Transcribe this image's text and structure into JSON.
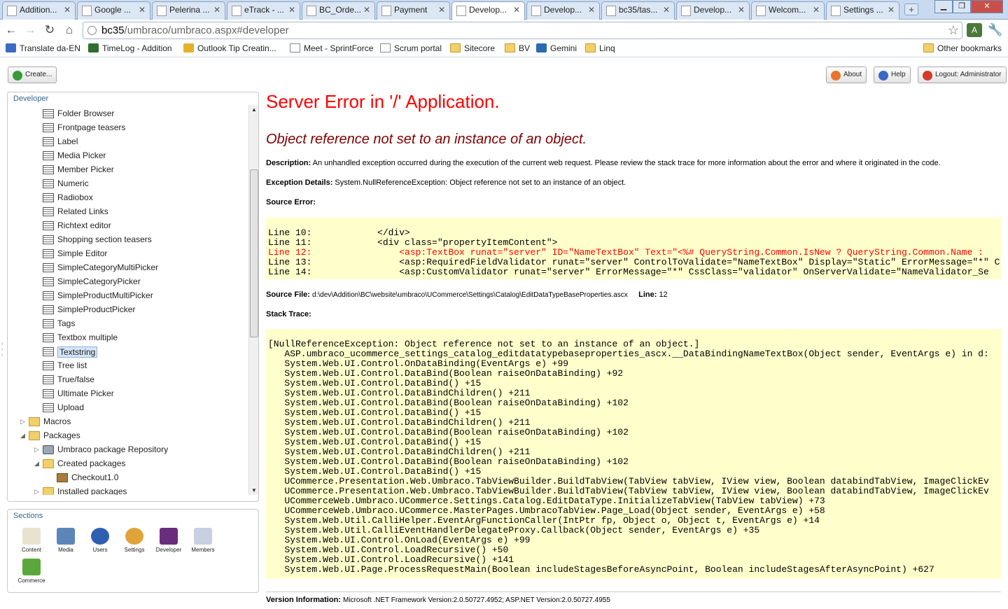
{
  "browser": {
    "tabs": [
      {
        "label": "Addition...",
        "active": false
      },
      {
        "label": "Google ...",
        "active": false
      },
      {
        "label": "Pelerina ...",
        "active": false
      },
      {
        "label": "eTrack - ...",
        "active": false
      },
      {
        "label": "BC_Orde...",
        "active": false
      },
      {
        "label": "Payment",
        "active": false
      },
      {
        "label": "Develop...",
        "active": true
      },
      {
        "label": "Develop...",
        "active": false
      },
      {
        "label": "bc35/tas...",
        "active": false
      },
      {
        "label": "Develop...",
        "active": false
      },
      {
        "label": "Welcom...",
        "active": false
      },
      {
        "label": "Settings ...",
        "active": false
      }
    ],
    "url_host": "bc35",
    "url_path": "/umbraco/umbraco.aspx#developer",
    "bookmarks": [
      {
        "label": "Translate da-EN",
        "icon": "translate-icon"
      },
      {
        "label": "TimeLog - Addition",
        "icon": "star-icon"
      },
      {
        "label": "Outlook Tip Creatin...",
        "icon": "outlook-icon"
      },
      {
        "label": "Meet - SprintForce",
        "icon": "page-icon"
      },
      {
        "label": "Scrum portal",
        "icon": "page-icon"
      },
      {
        "label": "Sitecore",
        "icon": "folder-icon"
      },
      {
        "label": "BV",
        "icon": "folder-icon"
      },
      {
        "label": "Gemini",
        "icon": "gemini-icon"
      },
      {
        "label": "Linq",
        "icon": "folder-icon"
      }
    ],
    "other_bookmarks": "Other bookmarks"
  },
  "umbraco": {
    "create_label": "Create...",
    "about_label": "About",
    "help_label": "Help",
    "logout_label": "Logout: Administrator",
    "tree_title": "Developer",
    "tree_items": [
      {
        "label": "Folder Browser",
        "icon": "datatype-icon"
      },
      {
        "label": "Frontpage teasers",
        "icon": "datatype-icon"
      },
      {
        "label": "Label",
        "icon": "datatype-icon"
      },
      {
        "label": "Media Picker",
        "icon": "datatype-icon"
      },
      {
        "label": "Member Picker",
        "icon": "datatype-icon"
      },
      {
        "label": "Numeric",
        "icon": "datatype-icon"
      },
      {
        "label": "Radiobox",
        "icon": "datatype-icon"
      },
      {
        "label": "Related Links",
        "icon": "datatype-icon"
      },
      {
        "label": "Richtext editor",
        "icon": "datatype-icon"
      },
      {
        "label": "Shopping section teasers",
        "icon": "datatype-icon"
      },
      {
        "label": "Simple Editor",
        "icon": "datatype-icon"
      },
      {
        "label": "SimpleCategoryMultiPicker",
        "icon": "datatype-icon"
      },
      {
        "label": "SimpleCategoryPicker",
        "icon": "datatype-icon"
      },
      {
        "label": "SimpleProductMultiPicker",
        "icon": "datatype-icon"
      },
      {
        "label": "SimpleProductPicker",
        "icon": "datatype-icon"
      },
      {
        "label": "Tags",
        "icon": "datatype-icon"
      },
      {
        "label": "Textbox multiple",
        "icon": "datatype-icon"
      },
      {
        "label": "Textstring",
        "icon": "datatype-icon",
        "selected": true
      },
      {
        "label": "Tree list",
        "icon": "datatype-icon"
      },
      {
        "label": "True/false",
        "icon": "datatype-icon"
      },
      {
        "label": "Ultimate Picker",
        "icon": "datatype-icon"
      },
      {
        "label": "Upload",
        "icon": "datatype-icon"
      },
      {
        "label": "Macros",
        "icon": "folder-icon"
      },
      {
        "label": "Packages",
        "icon": "folder-icon"
      },
      {
        "label": "Umbraco package Repository",
        "icon": "repository-icon"
      },
      {
        "label": "Created packages",
        "icon": "folder-icon"
      },
      {
        "label": "Checkout1.0",
        "icon": "package-icon"
      },
      {
        "label": "Installed packages",
        "icon": "folder-icon"
      }
    ],
    "sections_title": "Sections",
    "sections": [
      {
        "label": "Content",
        "icon": "content-icon"
      },
      {
        "label": "Media",
        "icon": "media-icon"
      },
      {
        "label": "Users",
        "icon": "users-icon"
      },
      {
        "label": "Settings",
        "icon": "settings-icon"
      },
      {
        "label": "Developer",
        "icon": "developer-icon"
      },
      {
        "label": "Members",
        "icon": "members-icon"
      },
      {
        "label": "Commerce",
        "icon": "commerce-icon"
      }
    ]
  },
  "error": {
    "title": "Server Error in '/' Application.",
    "message": "Object reference not set to an instance of an object.",
    "description_label": "Description:",
    "description": "An unhandled exception occurred during the execution of the current web request. Please review the stack trace for more information about the error and where it originated in the code.",
    "exception_label": "Exception Details:",
    "exception": "System.NullReferenceException: Object reference not set to an instance of an object.",
    "source_error_label": "Source Error:",
    "source_lines": [
      {
        "text": "Line 10:            </div>",
        "highlight": false
      },
      {
        "text": "Line 11:            <div class=\"propertyItemContent\">",
        "highlight": false
      },
      {
        "text": "Line 12:                <asp:TextBox runat=\"server\" ID=\"NameTextBox\" Text=\"<%# QueryString.Common.IsNew ? QueryString.Common.Name :",
        "highlight": true
      },
      {
        "text": "Line 13:                <asp:RequiredFieldValidator runat=\"server\" ControlToValidate=\"NameTextBox\" Display=\"Static\" ErrorMessage=\"*\" C",
        "highlight": false
      },
      {
        "text": "Line 14:                <asp:CustomValidator runat=\"server\" ErrorMessage=\"*\" CssClass=\"validator\" OnServerValidate=\"NameValidator_Se",
        "highlight": false
      }
    ],
    "source_file_label": "Source File:",
    "source_file": "d:\\dev\\Addition\\BC\\website\\umbraco\\UCommerce\\Settings\\Catalog\\EditDataTypeBaseProperties.ascx",
    "line_label": "Line:",
    "line": "12",
    "stack_label": "Stack Trace:",
    "stack_lines": [
      "[NullReferenceException: Object reference not set to an instance of an object.]",
      "   ASP.umbraco_ucommerce_settings_catalog_editdatatypebaseproperties_ascx.__DataBindingNameTextBox(Object sender, EventArgs e) in d:",
      "   System.Web.UI.Control.OnDataBinding(EventArgs e) +99",
      "   System.Web.UI.Control.DataBind(Boolean raiseOnDataBinding) +92",
      "   System.Web.UI.Control.DataBind() +15",
      "   System.Web.UI.Control.DataBindChildren() +211",
      "   System.Web.UI.Control.DataBind(Boolean raiseOnDataBinding) +102",
      "   System.Web.UI.Control.DataBind() +15",
      "   System.Web.UI.Control.DataBindChildren() +211",
      "   System.Web.UI.Control.DataBind(Boolean raiseOnDataBinding) +102",
      "   System.Web.UI.Control.DataBind() +15",
      "   System.Web.UI.Control.DataBindChildren() +211",
      "   System.Web.UI.Control.DataBind(Boolean raiseOnDataBinding) +102",
      "   System.Web.UI.Control.DataBind() +15",
      "   UCommerce.Presentation.Web.Umbraco.TabViewBuilder.BuildTabView(TabView tabView, IView view, Boolean databindTabView, ImageClickEv",
      "   UCommerce.Presentation.Web.Umbraco.TabViewBuilder.BuildTabView(TabView tabView, IView view, Boolean databindTabView, ImageClickEv",
      "   UCommerceWeb.Umbraco.UCommerce.Settings.Catalog.EditDataType.InitializeTabView(TabView tabView) +73",
      "   UCommerceWeb.Umbraco.UCommerce.MasterPages.UmbracoTabView.Page_Load(Object sender, EventArgs e) +58",
      "   System.Web.Util.CalliHelper.EventArgFunctionCaller(IntPtr fp, Object o, Object t, EventArgs e) +14",
      "   System.Web.Util.CalliEventHandlerDelegateProxy.Callback(Object sender, EventArgs e) +35",
      "   System.Web.UI.Control.OnLoad(EventArgs e) +99",
      "   System.Web.UI.Control.LoadRecursive() +50",
      "   System.Web.UI.Control.LoadRecursive() +141",
      "   System.Web.UI.Page.ProcessRequestMain(Boolean includeStagesBeforeAsyncPoint, Boolean includeStagesAfterAsyncPoint) +627"
    ],
    "version_label": "Version Information:",
    "version": "Microsoft .NET Framework Version:2.0.50727.4952; ASP.NET Version:2.0.50727.4955"
  }
}
